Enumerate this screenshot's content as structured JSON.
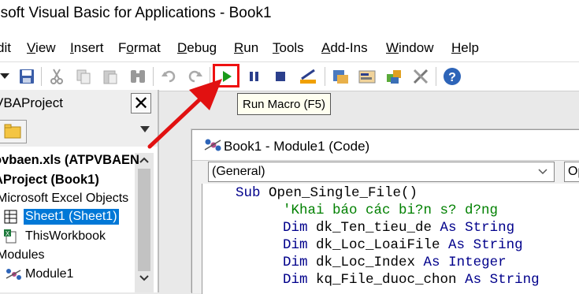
{
  "window": {
    "title": "osoft Visual Basic for Applications - Book1"
  },
  "menu": [
    {
      "label": "dit",
      "u": ""
    },
    {
      "label": "View",
      "u": "V"
    },
    {
      "label": "Insert",
      "u": "I"
    },
    {
      "label": "Format",
      "u": "o"
    },
    {
      "label": "Debug",
      "u": "D"
    },
    {
      "label": "Run",
      "u": "R"
    },
    {
      "label": "Tools",
      "u": "T"
    },
    {
      "label": "Add-Ins",
      "u": "A"
    },
    {
      "label": "Window",
      "u": "W"
    },
    {
      "label": "Help",
      "u": "H"
    }
  ],
  "toolbar": {
    "run_tooltip": "Run Macro (F5)"
  },
  "project": {
    "header": "VBAProject",
    "close": "✕",
    "tree": [
      "ovbaen.xls (ATPVBAEN",
      "AProject (Book1)",
      "Microsoft Excel Objects",
      "Sheet1 (Sheet1)",
      "ThisWorkbook",
      "Modules",
      "Module1"
    ]
  },
  "code_window": {
    "title": "Book1 - Module1 (Code)",
    "object_dropdown": "(General)",
    "proc_dropdown": "Op",
    "lines": {
      "l1_kw": "Sub",
      "l1_rest": " Open_Single_File()",
      "l2": "'Khai báo các bi?n s? d?ng",
      "l3_kw1": "Dim",
      "l3_mid": " dk_Ten_tieu_de ",
      "l3_kw2": "As",
      "l3_kw3": " String",
      "l4_kw1": "Dim",
      "l4_mid": " dk_Loc_LoaiFile ",
      "l4_kw2": "As",
      "l4_kw3": " String",
      "l5_kw1": "Dim",
      "l5_mid": " dk_Loc_Index ",
      "l5_kw2": "As",
      "l5_kw3": " Integer",
      "l6_kw1": "Dim",
      "l6_mid": " kq_File_duoc_chon ",
      "l6_kw2": "As",
      "l6_kw3": " String"
    }
  },
  "colors": {
    "highlight_red": "#e11111",
    "run_green": "#1a9a1a",
    "keyword_blue": "#00008b",
    "comment_green": "#008000",
    "selection_blue": "#0078d7"
  }
}
